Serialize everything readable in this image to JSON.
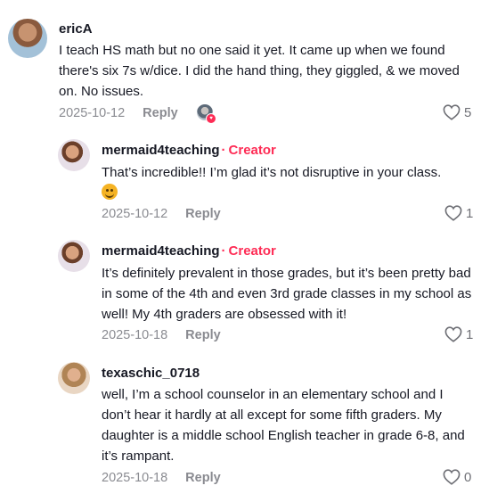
{
  "comments": [
    {
      "username": "ericA",
      "text": "I teach HS math but no one said it yet. It came up when we found there's six 7s w/dice. I did the hand thing, they giggled, & we moved on. No issues.",
      "date": "2025-10-12",
      "reply_label": "Reply",
      "likes": "5"
    },
    {
      "username": "mermaid4teaching",
      "badge": "Creator",
      "text": "That’s incredible!! I’m glad it’s not disruptive in your class.",
      "date": "2025-10-12",
      "reply_label": "Reply",
      "likes": "1"
    },
    {
      "username": "mermaid4teaching",
      "badge": "Creator",
      "text": "It’s definitely prevalent in those grades, but it’s been pretty bad in some of the 4th and even 3rd grade classes in my school as well! My 4th graders are obsessed with it!",
      "date": "2025-10-18",
      "reply_label": "Reply",
      "likes": "1"
    },
    {
      "username": "texaschic_0718",
      "text": "well, I’m a school counselor in an elementary school and I don’t hear it hardly at all except for some fifth graders. My daughter is a middle school English teacher in grade 6-8, and it’s rampant.",
      "date": "2025-10-18",
      "reply_label": "Reply",
      "likes": "0"
    }
  ],
  "icons": {
    "like": "heart-outline-icon",
    "creator_liked": "creator-liked-avatar-icon",
    "emoji": "smiling-face-emoji-icon"
  },
  "colors": {
    "creator_badge": "#fe2c55",
    "meta_gray": "#8a8b91",
    "text": "#161823"
  }
}
